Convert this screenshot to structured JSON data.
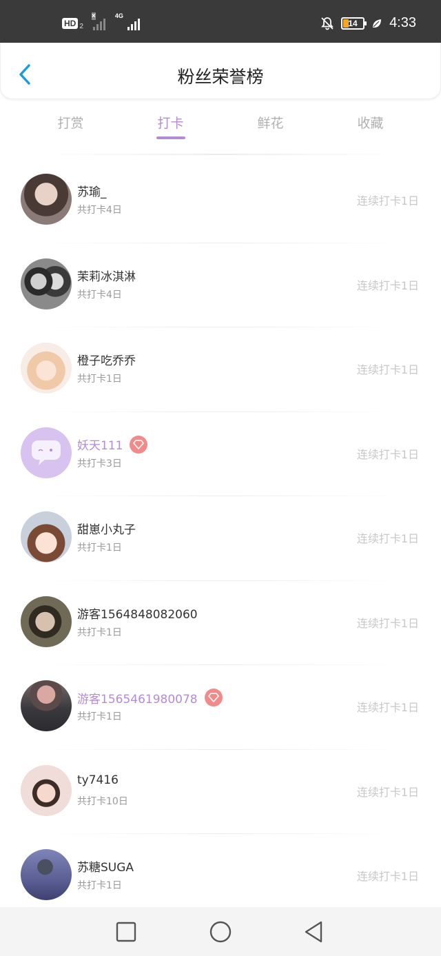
{
  "status_bar": {
    "time": "4:33",
    "battery_level": "14",
    "hd_label": "HD",
    "hd_sub": "2",
    "network_label": "4G",
    "icons": [
      "hd-icon",
      "signal-no-service-icon",
      "signal-4g-icon",
      "mute-bell-icon",
      "battery-icon",
      "leaf-eco-icon"
    ]
  },
  "header": {
    "title": "粉丝荣誉榜",
    "back_icon": "chevron-left-icon",
    "accent_color": "#1a9be0"
  },
  "tabs": [
    {
      "label": "打赏",
      "active": false
    },
    {
      "label": "打卡",
      "active": true
    },
    {
      "label": "鲜花",
      "active": false
    },
    {
      "label": "收藏",
      "active": false
    }
  ],
  "theme": {
    "accent": "#b48bd6",
    "badge": "#f28a8a"
  },
  "fans": [
    {
      "name": "苏瑜_",
      "total": "共打卡4日",
      "streak": "连续打卡1日",
      "vip": false
    },
    {
      "name": "茉莉冰淇淋",
      "total": "共打卡4日",
      "streak": "连续打卡1日",
      "vip": false
    },
    {
      "name": "橙子吃乔乔",
      "total": "共打卡1日",
      "streak": "连续打卡1日",
      "vip": false
    },
    {
      "name": "妖天111",
      "total": "共打卡3日",
      "streak": "连续打卡1日",
      "vip": true
    },
    {
      "name": "甜崽小丸子",
      "total": "共打卡1日",
      "streak": "连续打卡1日",
      "vip": false
    },
    {
      "name": "游客1564848082060",
      "total": "共打卡1日",
      "streak": "连续打卡1日",
      "vip": false
    },
    {
      "name": "游客1565461980078",
      "total": "共打卡1日",
      "streak": "连续打卡1日",
      "vip": true
    },
    {
      "name": "ty7416",
      "total": "共打卡10日",
      "streak": "连续打卡1日",
      "vip": false
    },
    {
      "name": "苏糖SUGA",
      "total": "共打卡1日",
      "streak": "连续打卡1日",
      "vip": false
    }
  ],
  "navbar": {
    "icons": [
      "recent-apps-square-icon",
      "home-circle-icon",
      "back-triangle-icon"
    ]
  }
}
